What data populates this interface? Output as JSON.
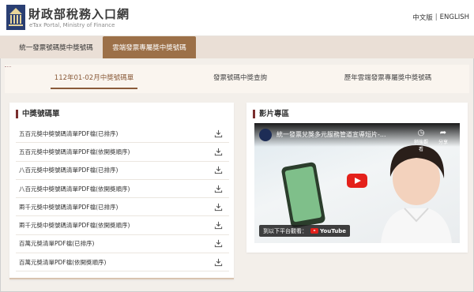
{
  "header": {
    "title": "財政部稅務入口網",
    "subtitle": "eTax Portal, Ministry of Finance",
    "lang_zh": "中文版",
    "lang_sep": "|",
    "lang_en": "ENGLISH"
  },
  "main_tabs": [
    {
      "label": "統一發票號碼獎中獎號碼",
      "active": false
    },
    {
      "label": "雲端發票專屬獎中獎號碼",
      "active": true
    }
  ],
  "sub_tabs": [
    {
      "label": "112年01-02月中獎號碼單",
      "active": true
    },
    {
      "label": "發票號碼中獎查詢",
      "active": false
    },
    {
      "label": "歷年雲端發票專屬獎中獎號碼",
      "active": false
    }
  ],
  "winning_list": {
    "title": "中獎號碼單",
    "items": [
      {
        "label": "五百元獎中獎號碼清單PDF檔(已排序)",
        "icon": "download-icon"
      },
      {
        "label": "五百元獎中獎號碼清單PDF檔(依開獎順序)",
        "icon": "download-icon"
      },
      {
        "label": "八百元獎中獎號碼清單PDF檔(已排序)",
        "icon": "download-icon"
      },
      {
        "label": "八百元獎中獎號碼清單PDF檔(依開獎順序)",
        "icon": "download-icon"
      },
      {
        "label": "兩千元獎中獎號碼清單PDF檔(已排序)",
        "icon": "download-icon"
      },
      {
        "label": "兩千元獎中獎號碼清單PDF檔(依開獎順序)",
        "icon": "download-icon"
      },
      {
        "label": "百萬元獎清單PDF檔(已排序)",
        "icon": "download-icon"
      },
      {
        "label": "百萬元獎清單PDF檔(依開獎順序)",
        "icon": "download-icon"
      }
    ]
  },
  "video": {
    "title": "影片專區",
    "video_title": "統一發票兌獎多元服務管道宣導短片-...",
    "watch_later": "稍後觀看",
    "share": "分享",
    "bottom_text": "到以下平台觀看：",
    "platform": "YouTube"
  },
  "colors": {
    "brand_brown": "#9c7048",
    "accent_red": "#7a2e2e",
    "youtube_red": "#e4211b"
  }
}
